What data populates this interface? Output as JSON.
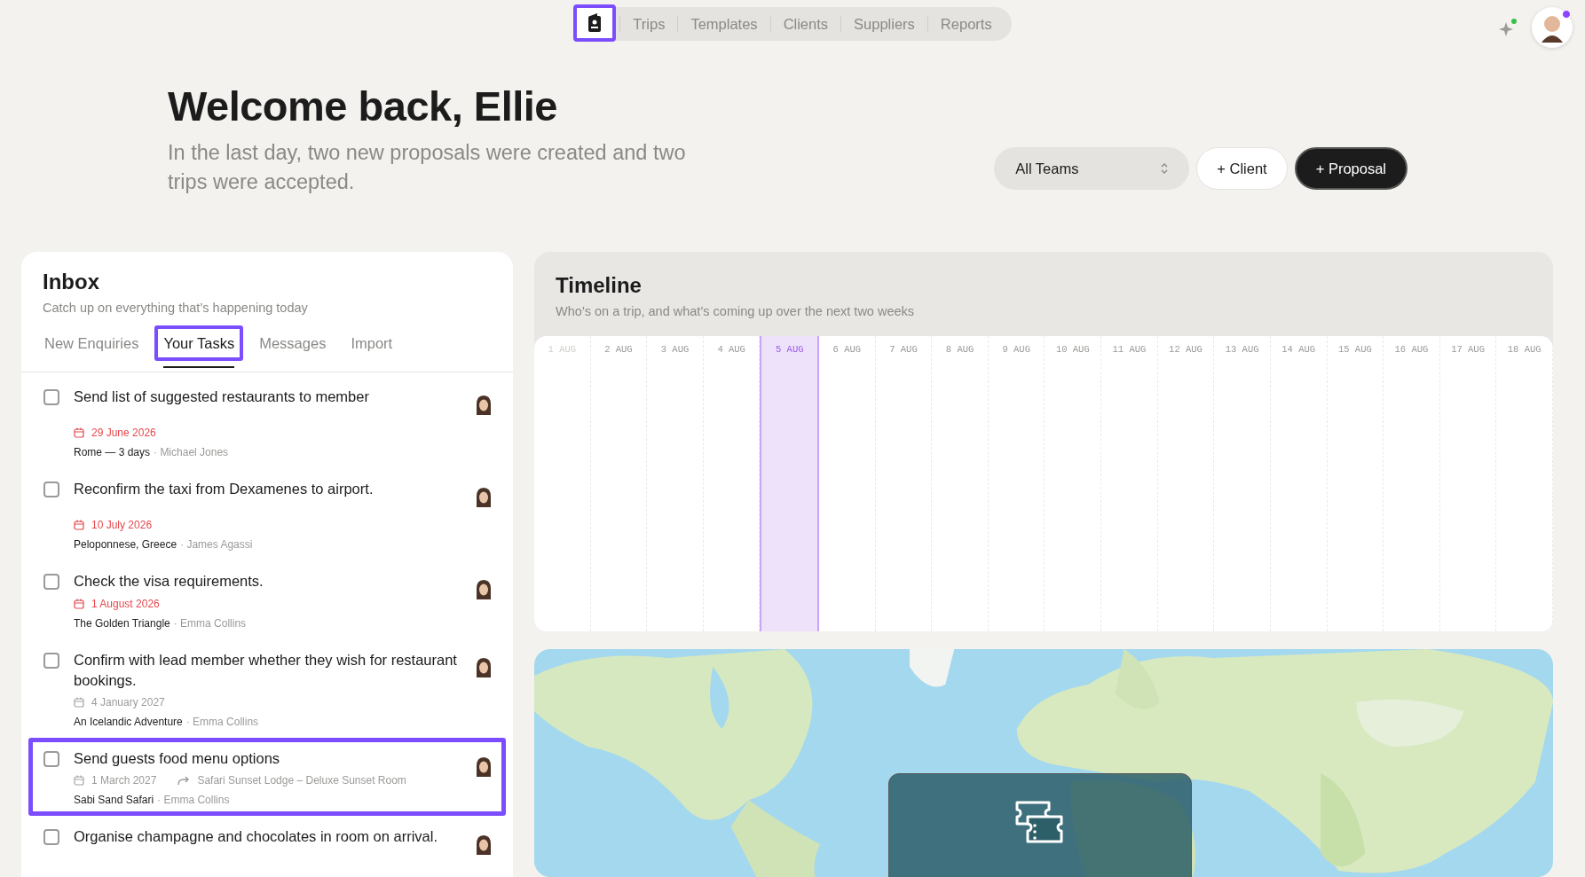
{
  "nav": {
    "logo": {
      "highlighted": true
    },
    "items": [
      {
        "label": "Trips",
        "selected": false
      },
      {
        "label": "Templates",
        "selected": false
      },
      {
        "label": "Clients",
        "selected": false
      },
      {
        "label": "Suppliers",
        "selected": false
      },
      {
        "label": "Reports",
        "selected": false
      }
    ]
  },
  "header": {
    "title": "Welcome back, Ellie",
    "subtitle": "In the last day, two new proposals were created and two trips were accepted."
  },
  "actions": {
    "team_select": "All Teams",
    "buttons": [
      {
        "label": "+ Client",
        "kind": "secondary"
      },
      {
        "label": "+ Proposal",
        "kind": "primary"
      }
    ]
  },
  "inbox": {
    "title": "Inbox",
    "subtitle": "Catch up on everything that’s happening today",
    "tabs": [
      {
        "label": "New Enquiries",
        "selected": false,
        "highlighted": false
      },
      {
        "label": "Your Tasks",
        "selected": true,
        "highlighted": true
      },
      {
        "label": "Messages",
        "selected": false,
        "highlighted": false
      },
      {
        "label": "Import",
        "selected": false,
        "highlighted": false
      }
    ],
    "tasks": [
      {
        "title": "Send list of suggested restaurants to member",
        "checked": false,
        "highlighted": false,
        "date": "29 June 2026",
        "overdue": true,
        "trip": "Rome — 3 days",
        "person": "· Michael Jones"
      },
      {
        "title": "Reconfirm the taxi from Dexamenes to airport.",
        "checked": false,
        "highlighted": false,
        "date": "10 July 2026",
        "overdue": true,
        "trip": "Peloponnese, Greece",
        "person": "· James Agassi"
      },
      {
        "title": "Check the visa requirements.",
        "checked": false,
        "highlighted": false,
        "date": "1 August 2026",
        "overdue": true,
        "trip": "The Golden Triangle",
        "person": "· Emma Collins"
      },
      {
        "title": "Confirm with lead member whether they wish for restaurant bookings.",
        "checked": false,
        "highlighted": false,
        "date": "4 January 2027",
        "overdue": false,
        "trip": "An Icelandic Adventure",
        "person": "· Emma Collins"
      },
      {
        "title": "Send guests food menu options",
        "checked": false,
        "highlighted": true,
        "date": "1 March 2027",
        "overdue": false,
        "link": "Safari Sunset Lodge – Deluxe Sunset Room",
        "trip": "Sabi Sand Safari",
        "person": "· Emma Collins"
      },
      {
        "title": "Organise champagne and chocolates in room on arrival.",
        "checked": false,
        "highlighted": false
      }
    ]
  },
  "timeline": {
    "title": "Timeline",
    "subtitle": "Who’s on a trip, and what’s coming up over the next two weeks",
    "days": [
      {
        "label": "1 AUG",
        "selected": false,
        "faded": true
      },
      {
        "label": "2 AUG",
        "selected": false,
        "faded": false
      },
      {
        "label": "3 AUG",
        "selected": false,
        "faded": false
      },
      {
        "label": "4 AUG",
        "selected": false,
        "faded": false
      },
      {
        "label": "5 AUG",
        "selected": true,
        "faded": false
      },
      {
        "label": "6 AUG",
        "selected": false,
        "faded": false
      },
      {
        "label": "7 AUG",
        "selected": false,
        "faded": false
      },
      {
        "label": "8 AUG",
        "selected": false,
        "faded": false
      },
      {
        "label": "9 AUG",
        "selected": false,
        "faded": false
      },
      {
        "label": "10 AUG",
        "selected": false,
        "faded": false
      },
      {
        "label": "11 AUG",
        "selected": false,
        "faded": false
      },
      {
        "label": "12 AUG",
        "selected": false,
        "faded": false
      },
      {
        "label": "13 AUG",
        "selected": false,
        "faded": false
      },
      {
        "label": "14 AUG",
        "selected": false,
        "faded": false
      },
      {
        "label": "15 AUG",
        "selected": false,
        "faded": false
      },
      {
        "label": "16 AUG",
        "selected": false,
        "faded": false
      },
      {
        "label": "17 AUG",
        "selected": false,
        "faded": false
      },
      {
        "label": "18 AUG",
        "selected": false,
        "faded": false
      }
    ]
  }
}
